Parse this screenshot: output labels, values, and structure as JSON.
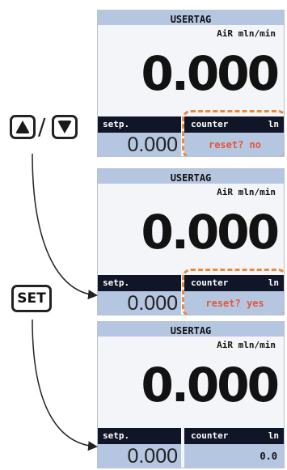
{
  "screens": [
    {
      "title": "USERTAG",
      "gas": "AiR mln/min",
      "reading": "0.000",
      "setp_label": "setp.",
      "setp_value": "0.000",
      "counter_label": "counter",
      "counter_unit": "ln",
      "counter_value": "reset? no",
      "highlighted": true
    },
    {
      "title": "USERTAG",
      "gas": "AiR mln/min",
      "reading": "0.000",
      "setp_label": "setp.",
      "setp_value": "0.000",
      "counter_label": "counter",
      "counter_unit": "ln",
      "counter_value": "reset? yes",
      "highlighted": true
    },
    {
      "title": "USERTAG",
      "gas": "AiR mln/min",
      "reading": "0.000",
      "setp_label": "setp.",
      "setp_value": "0.000",
      "counter_label": "counter",
      "counter_unit": "ln",
      "counter_value": "0.0",
      "highlighted": false
    }
  ],
  "keys": {
    "up_icon": "up-triangle-icon",
    "separator": "/",
    "down_icon": "down-triangle-icon",
    "set_label": "SET"
  },
  "colors": {
    "header_blue": "#b5c6e1",
    "label_dark": "#101528",
    "highlight_orange": "#ec8a3c",
    "alert_text": "#e05a3a"
  }
}
